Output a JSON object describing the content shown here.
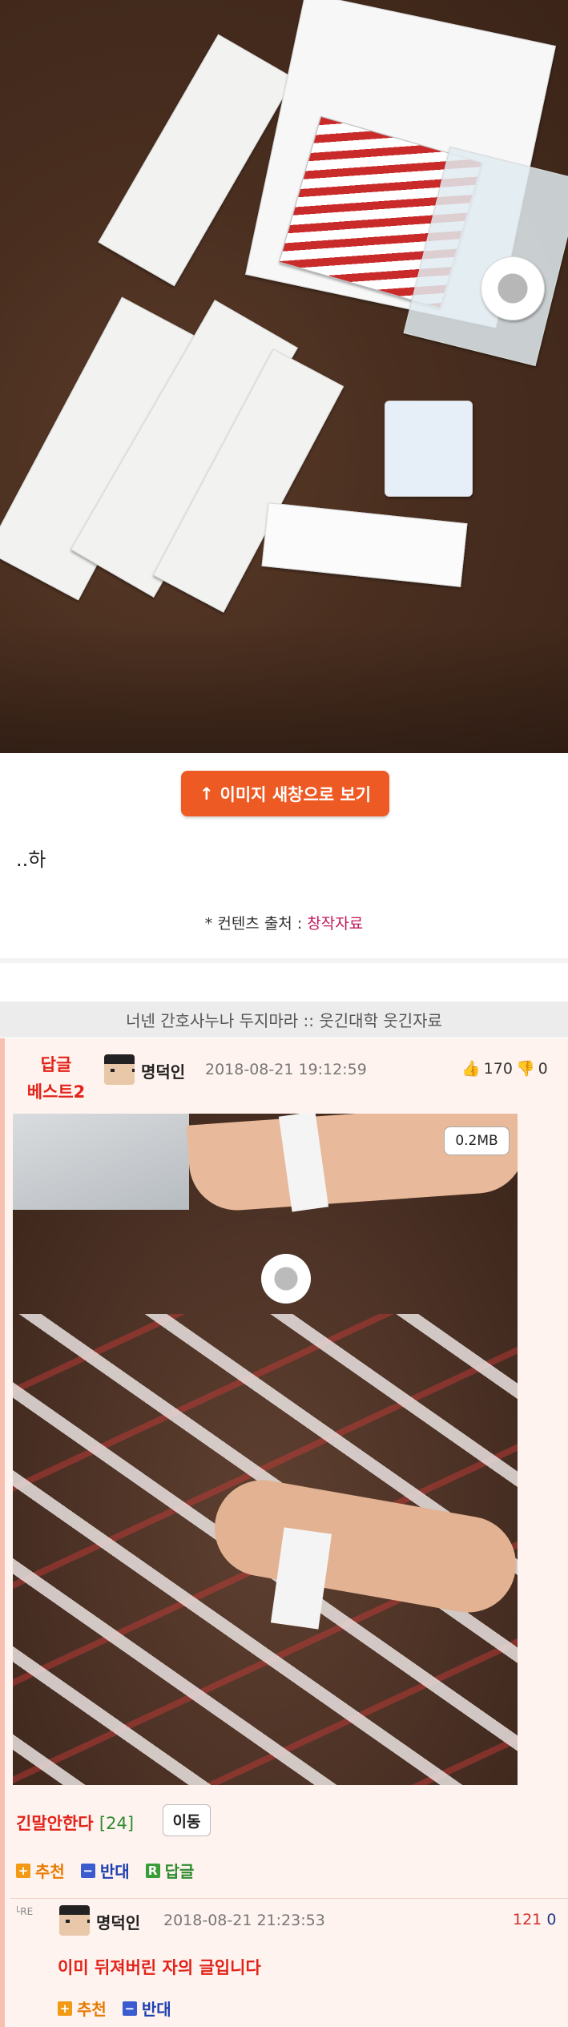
{
  "post": {
    "open_image_label": "이미지 새창으로 보기",
    "open_image_arrow": "↑",
    "body_text": "..하",
    "source_prefix": "* 컨텐츠 출처 : ",
    "source_link": "창작자료"
  },
  "title_bar": {
    "text": "너넨 간호사누나 두지마라 :: 웃긴대학 웃긴자료"
  },
  "comment": {
    "badge_line1": "답글",
    "badge_line2": "베스트2",
    "nickname": "명덕인",
    "datetime": "2018-08-21 19:12:59",
    "upvotes": "170",
    "downvotes": "0",
    "image_size": "0.2MB",
    "reply_post_title": "긴말안한다",
    "reply_post_count": "[24]",
    "move_label": "이동",
    "recommend_label": "추천",
    "oppose_label": "반대",
    "reply_label": "답글",
    "recommend_icon": "+",
    "oppose_icon": "−",
    "reply_icon": "R"
  },
  "reply": {
    "re_mark": "RE",
    "nickname": "명덕인",
    "datetime": "2018-08-21 21:23:53",
    "upvotes": "121",
    "downvotes": "0",
    "text": "이미 뒤져버린 자의 글입니다",
    "recommend_label": "추천",
    "oppose_label": "반대",
    "recommend_icon": "+",
    "oppose_icon": "−"
  },
  "colors": {
    "accent_orange": "#ee5a24",
    "best_red": "#e2231a",
    "panel_bg": "#fff3ef",
    "title_bar_bg": "#ececec"
  }
}
